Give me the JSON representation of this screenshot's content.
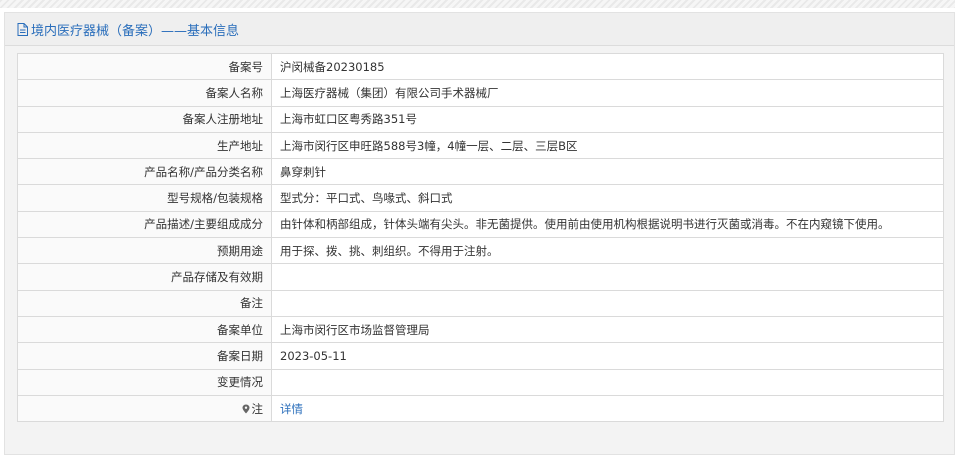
{
  "header": {
    "title": "境内医疗器械（备案）——基本信息"
  },
  "rows": [
    {
      "label": "备案号",
      "value": "沪闵械备20230185"
    },
    {
      "label": "备案人名称",
      "value": "上海医疗器械（集团）有限公司手术器械厂"
    },
    {
      "label": "备案人注册地址",
      "value": "上海市虹口区粤秀路351号"
    },
    {
      "label": "生产地址",
      "value": "上海市闵行区申旺路588号3幢，4幢一层、二层、三层B区"
    },
    {
      "label": "产品名称/产品分类名称",
      "value": "鼻穿刺针"
    },
    {
      "label": "型号规格/包装规格",
      "value": "型式分：平口式、鸟喙式、斜口式"
    },
    {
      "label": "产品描述/主要组成成分",
      "value": "由针体和柄部组成，针体头端有尖头。非无菌提供。使用前由使用机构根据说明书进行灭菌或消毒。不在内窥镜下使用。"
    },
    {
      "label": "预期用途",
      "value": "用于探、拨、挑、刺组织。不得用于注射。"
    },
    {
      "label": "产品存储及有效期",
      "value": ""
    },
    {
      "label": "备注",
      "value": ""
    },
    {
      "label": "备案单位",
      "value": "上海市闵行区市场监督管理局"
    },
    {
      "label": "备案日期",
      "value": "2023-05-11"
    },
    {
      "label": "变更情况",
      "value": ""
    },
    {
      "label": "注",
      "value": "详情"
    }
  ],
  "colors": {
    "accent": "#2a6ebb",
    "border": "#dadada"
  },
  "icons": {
    "header": "document-icon",
    "note": "map-pin-icon"
  }
}
